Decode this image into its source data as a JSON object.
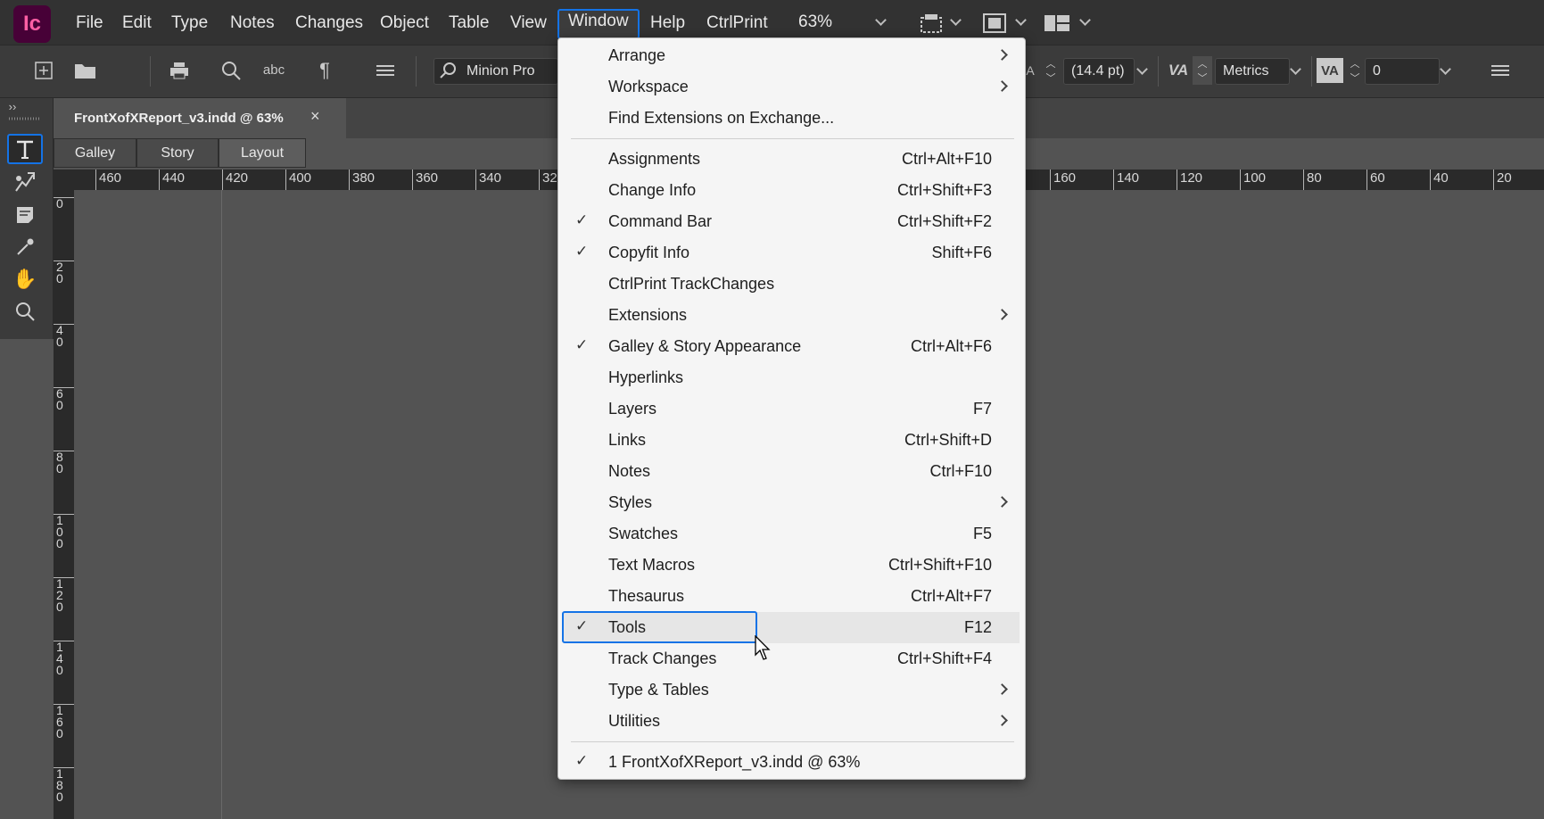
{
  "app": {
    "logo": "Ic"
  },
  "menubar": {
    "items": [
      "File",
      "Edit",
      "Type",
      "Notes",
      "Changes",
      "Object",
      "Table",
      "View",
      "Window",
      "Help",
      "CtrlPrint"
    ],
    "active": "Window",
    "zoom": "63%"
  },
  "controlbar": {
    "font_name": "Minion Pro",
    "leading": "(14.4 pt)",
    "kerning": "Metrics",
    "tracking": "0"
  },
  "document": {
    "tab_title": "FrontXofXReport_v3.indd @ 63%",
    "close_glyph": "×",
    "views": [
      "Galley",
      "Story",
      "Layout"
    ],
    "active_view": "Layout"
  },
  "rulers": {
    "h_left": [
      "460",
      "440",
      "420",
      "400",
      "380",
      "360",
      "340",
      "32"
    ],
    "h_right": [
      "160",
      "140",
      "120",
      "100",
      "80",
      "60",
      "40",
      "20"
    ],
    "v": [
      "0",
      "2\n0",
      "4\n0",
      "6\n0",
      "8\n0",
      "1\n0\n0",
      "1\n2\n0",
      "1\n4\n0",
      "1\n6\n0",
      "1\n8\n0"
    ]
  },
  "window_menu": {
    "items": [
      {
        "label": "Arrange",
        "shortcut": "",
        "check": false,
        "submenu": true
      },
      {
        "label": "Workspace",
        "shortcut": "",
        "check": false,
        "submenu": true
      },
      {
        "label": "Find Extensions on Exchange...",
        "shortcut": "",
        "check": false,
        "submenu": false
      },
      {
        "label": "Assignments",
        "shortcut": "Ctrl+Alt+F10",
        "check": false,
        "submenu": false
      },
      {
        "label": "Change Info",
        "shortcut": "Ctrl+Shift+F3",
        "check": false,
        "submenu": false
      },
      {
        "label": "Command Bar",
        "shortcut": "Ctrl+Shift+F2",
        "check": true,
        "submenu": false
      },
      {
        "label": "Copyfit Info",
        "shortcut": "Shift+F6",
        "check": true,
        "submenu": false
      },
      {
        "label": "CtrlPrint TrackChanges",
        "shortcut": "",
        "check": false,
        "submenu": false
      },
      {
        "label": "Extensions",
        "shortcut": "",
        "check": false,
        "submenu": true
      },
      {
        "label": "Galley & Story Appearance",
        "shortcut": "Ctrl+Alt+F6",
        "check": true,
        "submenu": false
      },
      {
        "label": "Hyperlinks",
        "shortcut": "",
        "check": false,
        "submenu": false
      },
      {
        "label": "Layers",
        "shortcut": "F7",
        "check": false,
        "submenu": false
      },
      {
        "label": "Links",
        "shortcut": "Ctrl+Shift+D",
        "check": false,
        "submenu": false
      },
      {
        "label": "Notes",
        "shortcut": "Ctrl+F10",
        "check": false,
        "submenu": false
      },
      {
        "label": "Styles",
        "shortcut": "",
        "check": false,
        "submenu": true
      },
      {
        "label": "Swatches",
        "shortcut": "F5",
        "check": false,
        "submenu": false
      },
      {
        "label": "Text Macros",
        "shortcut": "Ctrl+Shift+F10",
        "check": false,
        "submenu": false
      },
      {
        "label": "Thesaurus",
        "shortcut": "Ctrl+Alt+F7",
        "check": false,
        "submenu": false
      },
      {
        "label": "Tools",
        "shortcut": "F12",
        "check": true,
        "submenu": false
      },
      {
        "label": "Track Changes",
        "shortcut": "Ctrl+Shift+F4",
        "check": false,
        "submenu": false
      },
      {
        "label": "Type & Tables",
        "shortcut": "",
        "check": false,
        "submenu": true
      },
      {
        "label": "Utilities",
        "shortcut": "",
        "check": false,
        "submenu": true
      },
      {
        "label": "1 FrontXofXReport_v3.indd @ 63%",
        "shortcut": "",
        "check": true,
        "submenu": false
      }
    ],
    "check_glyph": "✓"
  },
  "colors": {
    "accent": "#1473e6",
    "logo_bg": "#470137",
    "logo_fg": "#ff5fa5"
  }
}
